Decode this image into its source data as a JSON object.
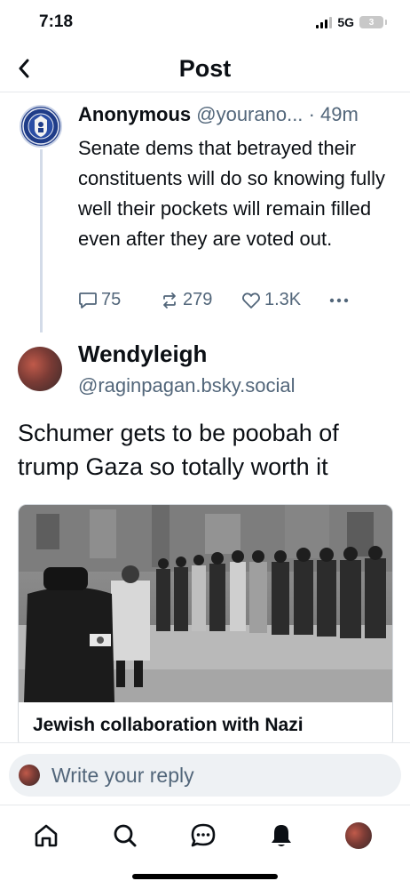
{
  "status_bar": {
    "time": "7:18",
    "network": "5G",
    "battery": "3"
  },
  "header": {
    "title": "Post"
  },
  "parent_post": {
    "author": "Anonymous",
    "handle": "@yourano...",
    "age": "· 49m",
    "text": "Senate dems that betrayed their constituents will do so knowing fully well their pockets will remain filled even after they are voted out.",
    "replies": "75",
    "reposts": "279",
    "likes": "1.3K"
  },
  "main_post": {
    "author": "Wendyleigh",
    "handle": "@raginpagan.bsky.social",
    "text": "Schumer gets to be poobah of trump Gaza so totally worth it",
    "embed": {
      "title": "Jewish collaboration with Nazi"
    }
  },
  "reply": {
    "placeholder": "Write your reply"
  },
  "tabs": [
    "home-icon",
    "search-icon",
    "chat-icon",
    "bell-icon",
    "profile-avatar"
  ],
  "colors": {
    "text": "#0b0f14",
    "muted": "#52667a",
    "thread_line": "#d3dbe8",
    "border": "#e6e8eb",
    "input_bg": "#eef1f4"
  }
}
